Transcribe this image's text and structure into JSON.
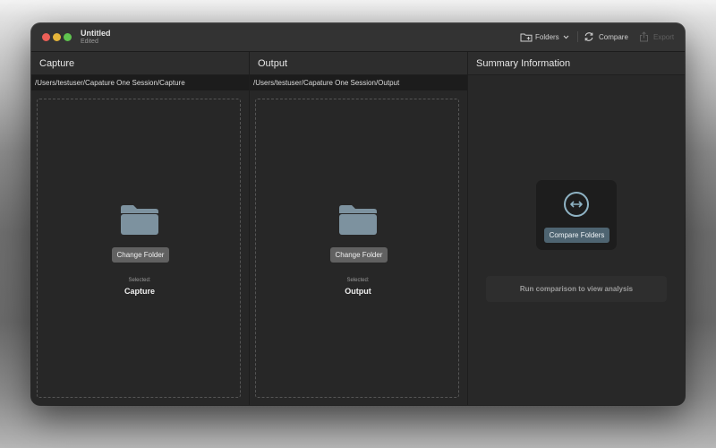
{
  "window": {
    "title": "Untitled",
    "subtitle": "Edited"
  },
  "toolbar": {
    "folders_label": "Folders",
    "compare_label": "Compare",
    "export_label": "Export"
  },
  "columns": [
    {
      "header": "Capture",
      "path": "/Users/testuser/Capature One Session/Capture",
      "change_button": "Change Folder",
      "selected_label": "Selected:",
      "selected_value": "Capture"
    },
    {
      "header": "Output",
      "path": "/Users/testuser/Capature One Session/Output",
      "change_button": "Change Folder",
      "selected_label": "Selected:",
      "selected_value": "Output"
    }
  ],
  "summary": {
    "header": "Summary Information",
    "compare_button": "Compare Folders",
    "placeholder": "Run comparison to view analysis"
  },
  "icons": {
    "folder": "folder-icon",
    "compare": "arrows-left-right-icon",
    "refresh": "refresh-icon",
    "export": "share-icon"
  },
  "colors": {
    "folder_icon": "#7d929f",
    "compare_accent": "#8fb3c4",
    "compare_button": "#4e6471"
  }
}
